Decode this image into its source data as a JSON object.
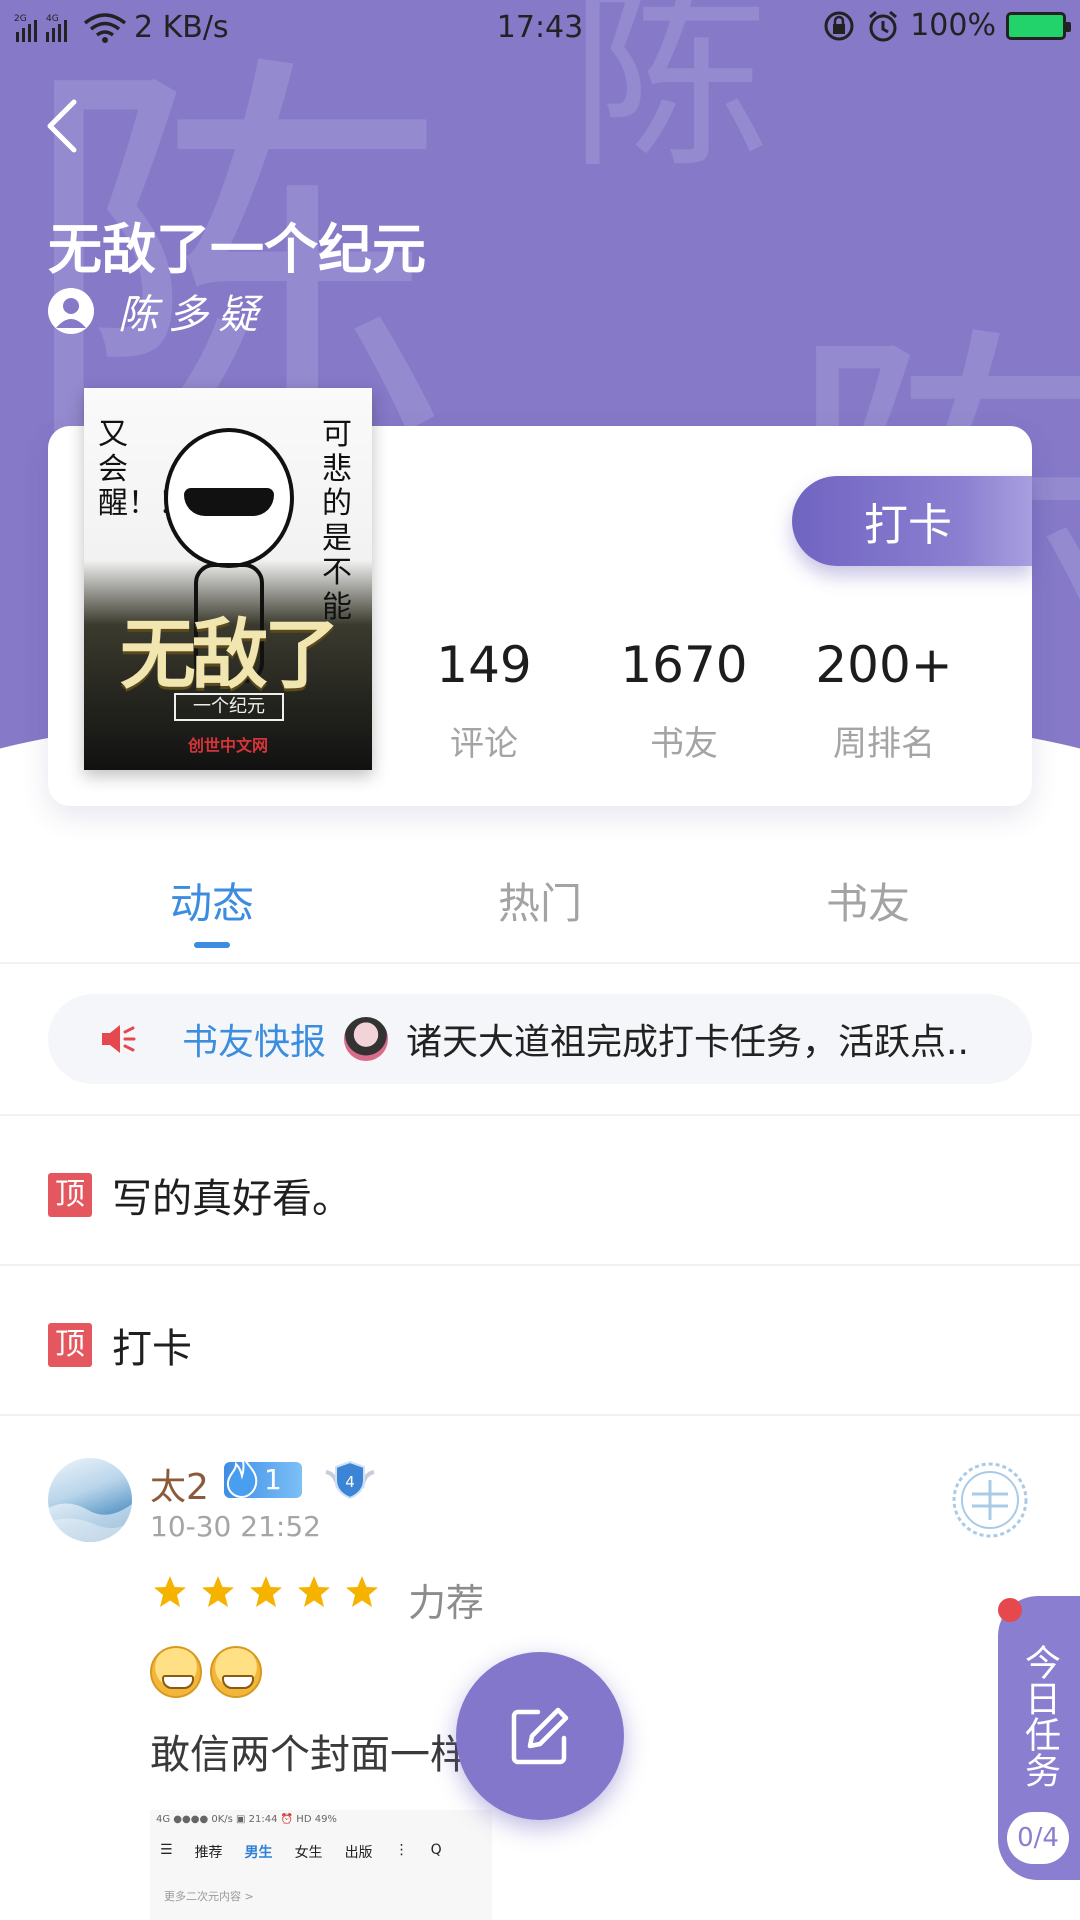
{
  "status_bar": {
    "network_speed": "2 KB/s",
    "time": "17:43",
    "battery": "100%",
    "signal_labels": [
      "2G",
      "4G"
    ]
  },
  "book": {
    "title": "无敌了一个纪元",
    "author": "陈多疑",
    "watermark": "陈",
    "cover": {
      "big_text": "无敌了",
      "subtitle": "一个纪元",
      "publisher": "创世中文网",
      "side_left": "又会醒！！",
      "side_right": "可悲的是不能"
    }
  },
  "checkin_label": "打卡",
  "stats": [
    {
      "value": "149",
      "label": "评论"
    },
    {
      "value": "1670",
      "label": "书友"
    },
    {
      "value": "200+",
      "label": "周排名"
    }
  ],
  "tabs": [
    {
      "label": "动态",
      "active": true
    },
    {
      "label": "热门",
      "active": false
    },
    {
      "label": "书友",
      "active": false
    }
  ],
  "news": {
    "label": "书友快报",
    "text": "诸天大道祖完成打卡任务，活跃点..."
  },
  "pinned": [
    {
      "badge": "顶",
      "text": "写的真好看。"
    },
    {
      "badge": "顶",
      "text": "打卡"
    }
  ],
  "comment": {
    "username": "太2",
    "level": "1",
    "badge_level": "4",
    "date": "10-30 21:52",
    "rating": 5,
    "rating_text": "力荐",
    "emoji_count": 2,
    "text": "敢信两个封面一样",
    "thumbnail": {
      "status": "4G ●●●● 0K/s ▣    21:44    ⏰ HD 49%",
      "nav": [
        "☰",
        "推荐",
        "男生",
        "女生",
        "出版",
        "⋮",
        "Q"
      ],
      "active_nav": "男生",
      "sub": "更多二次元内容 >"
    }
  },
  "task": {
    "label": "今日任务",
    "progress": "0/4"
  },
  "colors": {
    "header": "#8579c8",
    "accent_blue": "#3c8de0",
    "pin_red": "#e5575e",
    "star": "#f5b300"
  }
}
